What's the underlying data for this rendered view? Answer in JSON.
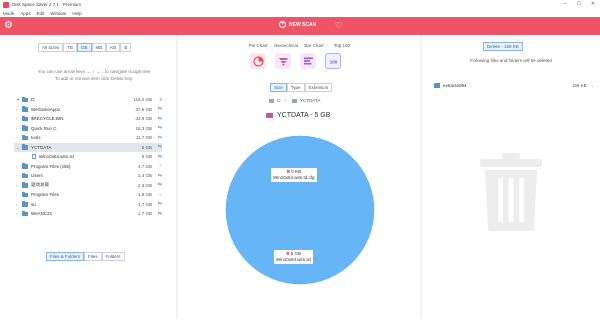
{
  "window": {
    "title": "Disk Space Saver 2.7.1 - Premium",
    "controls": [
      "–",
      "☐",
      "✕"
    ]
  },
  "menu": [
    "Mode",
    "Apps",
    "Edit",
    "Window",
    "Help"
  ],
  "toolbar": {
    "new_scan_label": "NEW SCAN",
    "accent": "#ef5466"
  },
  "left": {
    "size_units": [
      "All Sizes",
      "TB",
      "GB",
      "MB",
      "KB",
      "B"
    ],
    "active_unit": "GB",
    "hint_line1": "You can use arrow keys ← ↑ → ↓ to navigate trough tree",
    "hint_line2": "To add or remove item click Delete key.",
    "tree": [
      {
        "name": "D:",
        "size": "118.2 GB",
        "action": "x",
        "level": 0,
        "expand": "▼",
        "type": "folder"
      },
      {
        "name": "WeGameApps",
        "size": "37.6 GB",
        "action": "⇆",
        "level": 1,
        "expand": "›",
        "type": "folder"
      },
      {
        "name": "$RECYCLE.BIN",
        "size": "33.9 GB",
        "action": "⇆",
        "level": 1,
        "expand": "›",
        "type": "folder"
      },
      {
        "name": "Quick Run C",
        "size": "18.3 GB",
        "action": "⇆",
        "level": 1,
        "expand": "›",
        "type": "folder"
      },
      {
        "name": "tools",
        "size": "11.7 GB",
        "action": "⇆",
        "level": 1,
        "expand": "›",
        "type": "folder"
      },
      {
        "name": "YCTDATA",
        "size": "5 GB",
        "action": "⇆",
        "level": 1,
        "expand": "⌄",
        "type": "folder",
        "selected": true
      },
      {
        "name": "Win10x64.wim.tcl",
        "size": "5 GB",
        "action": "⇆",
        "level": 2,
        "expand": "",
        "type": "file"
      },
      {
        "name": "Program Files (x86)",
        "size": "4.7 GB",
        "action": "○",
        "level": 1,
        "expand": "›",
        "type": "folder"
      },
      {
        "name": "Users",
        "size": "3.4 GB",
        "action": "⇆",
        "level": 1,
        "expand": "›",
        "type": "folder"
      },
      {
        "name": "驱动总裁",
        "size": "2.3 GB",
        "action": "⇆",
        "level": 1,
        "expand": "›",
        "type": "folder"
      },
      {
        "name": "Program Files",
        "size": "1.9 GB",
        "action": "○",
        "level": 1,
        "expand": "›",
        "type": "folder"
      },
      {
        "name": "su",
        "size": "1.7 GB",
        "action": "⇆",
        "level": 1,
        "expand": "›",
        "type": "folder"
      },
      {
        "name": "WeANC21",
        "size": "1.7 GB",
        "action": "⇆",
        "level": 1,
        "expand": "›",
        "type": "folder"
      }
    ],
    "bottom_tabs": [
      "Files & Folders",
      "Files",
      "Folders"
    ],
    "active_bottom_tab": "Files & Folders"
  },
  "middle": {
    "chart_types": [
      "Pie Chart",
      "Hierarchical",
      "Bar Chart",
      "Top 100"
    ],
    "active_chart_type": "Top 100",
    "sub_tabs": [
      "Size",
      "Type",
      "Extension"
    ],
    "active_sub_tab": "Size",
    "breadcrumb": {
      "drive": "C:",
      "sep": "›",
      "folder": "YCTDATA"
    },
    "current_folder": "YCTDATA - 5 GB",
    "pie_color": "#65b5f7",
    "pie_tooltip_top": {
      "size": "0 KB",
      "name": "Win10x64.wim.td.cfg"
    },
    "pie_tooltip_bottom": {
      "size": "5 GB",
      "name": "Win10x64.wim.tcl"
    }
  },
  "chart_data": {
    "type": "pie",
    "categories": [
      "Win10x64.wim.td.cfg",
      "Win10x64.wim.tcl"
    ],
    "values": [
      0.0001,
      5
    ],
    "title": "YCTDATA - 5 GB"
  },
  "right": {
    "delete_tab": "Delete - 159 KB",
    "note": "Following files and folders will be deleted",
    "items": [
      {
        "name": "extracted94",
        "size": "159 KB"
      }
    ]
  }
}
